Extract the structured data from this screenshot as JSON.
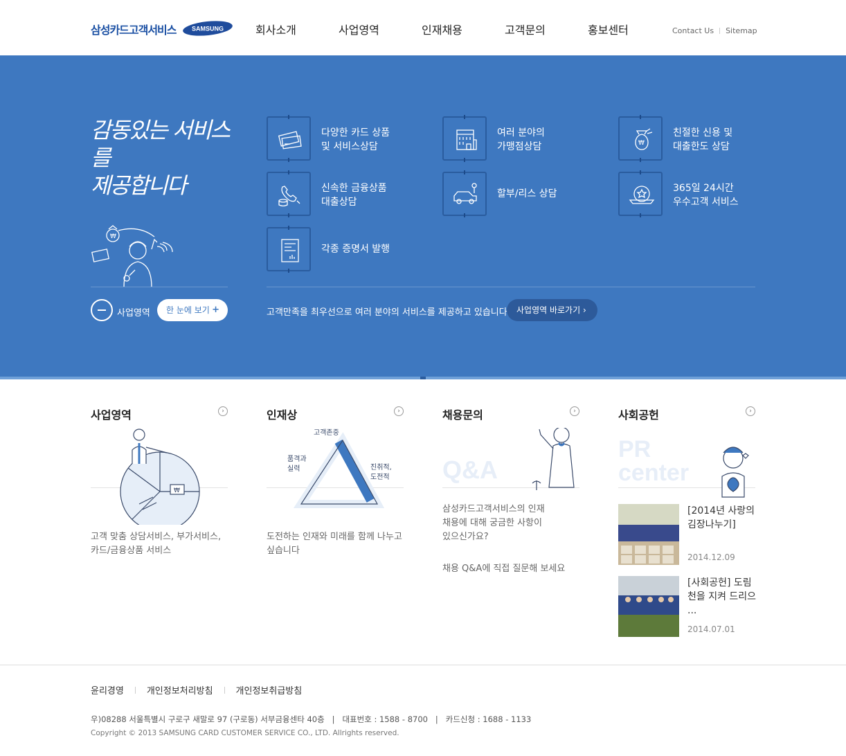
{
  "header": {
    "logo_text": "삼성카드고객서비스",
    "samsung_logo": "SAMSUNG",
    "nav": [
      "회사소개",
      "사업영역",
      "인재채용",
      "고객문의",
      "홍보센터"
    ],
    "util": [
      "Contact Us",
      "Sitemap"
    ]
  },
  "hero": {
    "slogan_1": "감동있는 서비스를",
    "slogan_2": "제공합니다",
    "services": [
      {
        "line1": "다양한 카드 상품",
        "line2": "및 서비스상담",
        "icon": "card-icon"
      },
      {
        "line1": "여러 분야의",
        "line2": "가맹점상담",
        "icon": "building-icon"
      },
      {
        "line1": "친절한 신용 및",
        "line2": "대출한도 상담",
        "icon": "money-bag-icon"
      },
      {
        "line1": "신속한 금융상품",
        "line2": "대출상담",
        "icon": "phone-coins-icon"
      },
      {
        "line1": "할부/리스 상담",
        "line2": "",
        "icon": "car-icon"
      },
      {
        "line1": "365일 24시간",
        "line2": "우수고객 서비스",
        "icon": "badge-icon"
      },
      {
        "line1": "각종 증명서 발행",
        "line2": "",
        "icon": "document-icon"
      }
    ],
    "biz_label": "사업영역",
    "view_button": "한 눈에 보기",
    "description": "고객만족을 최우선으로 여러 분야의 서비스를 제공하고 있습니다.",
    "go_button": "사업영역 바로가기 ›"
  },
  "sections": {
    "biz": {
      "title": "사업영역",
      "desc_1": "고객 맞춤 상담서비스, 부가서비스,",
      "desc_2": "카드/금융상품 서비스"
    },
    "talent": {
      "title": "인재상",
      "desc_1": "도전하는 인재와 미래를 함께 나누고",
      "desc_2": "싶습니다",
      "label_1": "고객존중",
      "label_2a": "품격과",
      "label_2b": "실력",
      "label_3a": "진취적,",
      "label_3b": "도전적"
    },
    "recruit": {
      "title": "채용문의",
      "watermark": "Q&A",
      "desc_1": "삼성카드고객서비스의 인재",
      "desc_2": "채용에 대해 궁금한 사항이",
      "desc_3": "있으신가요?",
      "desc_4": "채용 Q&A에 직접 질문해 보세요"
    },
    "social": {
      "title": "사회공헌",
      "watermark_1": "PR",
      "watermark_2": "center"
    }
  },
  "news": [
    {
      "title": "[2014년 사랑의 김장나누기]",
      "date": "2014.12.09"
    },
    {
      "title": "[사회공헌] 도림천을 지켜 드리으 ...",
      "date": "2014.07.01"
    }
  ],
  "footer": {
    "links": [
      "윤리경영",
      "개인정보처리방침",
      "개인정보취급방침"
    ],
    "address": "우)08288 서울특별시 구로구 새말로 97 (구로동) 서부금융센타 40층   |   대표번호 : 1588 - 8700   |   카드신청 : 1688 - 1133",
    "copyright": "Copyright © 2013 SAMSUNG CARD CUSTOMER SERVICE CO., LTD. Allrights reserved."
  }
}
